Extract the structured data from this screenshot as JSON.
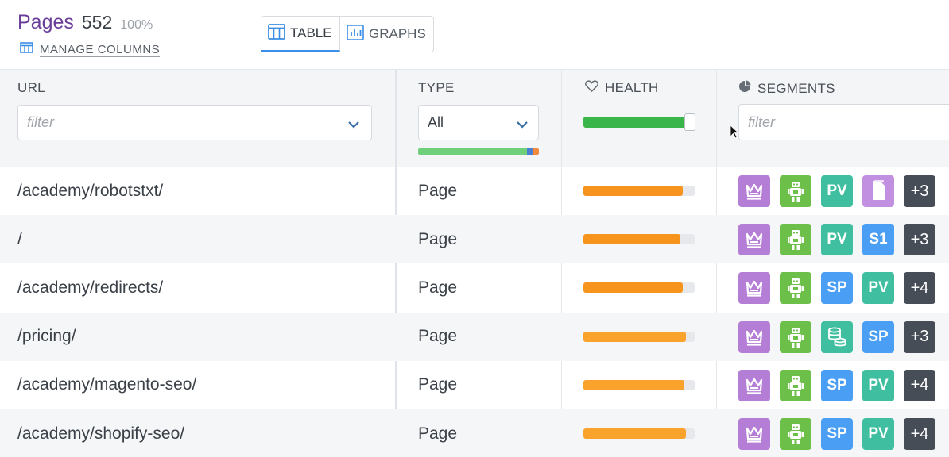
{
  "header": {
    "title": "Pages",
    "count": "552",
    "percent": "100%",
    "manage_columns": "MANAGE COLUMNS",
    "view_table": "TABLE",
    "view_graphs": "GRAPHS"
  },
  "columns": {
    "url": {
      "label": "URL",
      "filter_placeholder": "filter"
    },
    "type": {
      "label": "TYPE",
      "selected": "All"
    },
    "health": {
      "label": "HEALTH",
      "range_fraction": 0.95
    },
    "segments": {
      "label": "SEGMENTS",
      "filter_placeholder": "filter"
    }
  },
  "colors": {
    "purple_title": "#6a3d98",
    "accent_blue": "#3a8ee6",
    "health_green": "#3ab54a",
    "health_orange": "#f7941d",
    "badge_crown": "#b57ed6",
    "badge_robot": "#6cc04a",
    "badge_pv": "#3fbf9f",
    "badge_sp": "#4a9ff5",
    "badge_s1": "#4a9ff5",
    "badge_doc": "#c290e0",
    "badge_db": "#3fbf9f",
    "badge_more": "#464d57"
  },
  "rows": [
    {
      "url": "/academy/robotstxt/",
      "type": "Page",
      "health": 0.89,
      "health_color": "#f7941d",
      "badges": [
        "crown-icon",
        "robot-icon",
        "PV",
        "document-icon"
      ],
      "more": "+3"
    },
    {
      "url": "/",
      "type": "Page",
      "health": 0.87,
      "health_color": "#f7941d",
      "badges": [
        "crown-icon",
        "robot-icon",
        "PV",
        "S1"
      ],
      "more": "+3"
    },
    {
      "url": "/academy/redirects/",
      "type": "Page",
      "health": 0.89,
      "health_color": "#f7941d",
      "badges": [
        "crown-icon",
        "robot-icon",
        "SP",
        "PV"
      ],
      "more": "+4"
    },
    {
      "url": "/pricing/",
      "type": "Page",
      "health": 0.92,
      "health_color": "#f9a32c",
      "badges": [
        "crown-icon",
        "robot-icon",
        "database-icon",
        "SP"
      ],
      "more": "+3"
    },
    {
      "url": "/academy/magento-seo/",
      "type": "Page",
      "health": 0.91,
      "health_color": "#f9a32c",
      "badges": [
        "crown-icon",
        "robot-icon",
        "SP",
        "PV"
      ],
      "more": "+4"
    },
    {
      "url": "/academy/shopify-seo/",
      "type": "Page",
      "health": 0.92,
      "health_color": "#f9a32c",
      "badges": [
        "crown-icon",
        "robot-icon",
        "SP",
        "PV"
      ],
      "more": "+4"
    }
  ]
}
